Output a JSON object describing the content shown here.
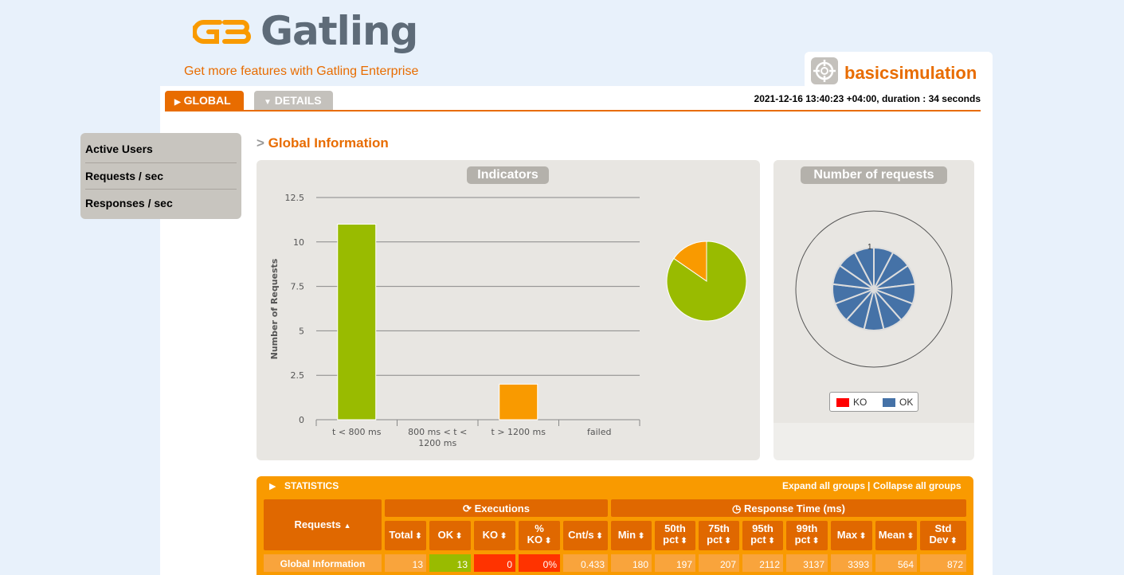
{
  "header": {
    "brand": "Gatling",
    "enterprise_link": "Get more features with Gatling Enterprise",
    "simulation_name": "basicsimulation",
    "run_info": "2021-12-16 13:40:23 +04:00, duration : 34 seconds"
  },
  "tabs": {
    "global": "GLOBAL",
    "details": "DETAILS"
  },
  "sidebar": {
    "items": [
      {
        "label": "Active Users"
      },
      {
        "label": "Requests / sec"
      },
      {
        "label": "Responses / sec"
      }
    ]
  },
  "main": {
    "section_marker": ">",
    "section_title": "Global Information"
  },
  "colors": {
    "accent": "#e86c00",
    "ok_green": "#99bb00",
    "orange": "#f99a00",
    "ko_red": "#ff0000",
    "ok_blue": "#4572a7"
  },
  "chart_data": [
    {
      "type": "bar",
      "title": "Indicators",
      "ylabel": "Number of Requests",
      "categories": [
        "t < 800 ms",
        "800 ms < t < 1200 ms",
        "t > 1200 ms",
        "failed"
      ],
      "values": [
        11,
        0,
        2,
        0
      ],
      "bar_colors": [
        "#99bb00",
        "#ffa500",
        "#f99a00",
        "#ff0000"
      ],
      "ylim": [
        0,
        12.5
      ],
      "yticks": [
        "0",
        "2.5",
        "5",
        "7.5",
        "10",
        "12.5"
      ],
      "grid": true,
      "pie": [
        {
          "label": "t < 800 ms",
          "value": 11,
          "color": "#99bb00"
        },
        {
          "label": "t > 1200 ms",
          "value": 2,
          "color": "#f99a00"
        }
      ]
    },
    {
      "type": "pie",
      "title": "Number of requests",
      "slices": 13,
      "axis_label": "1",
      "legend": [
        {
          "label": "KO",
          "color": "#ff0000"
        },
        {
          "label": "OK",
          "color": "#4572a7"
        }
      ]
    }
  ],
  "statistics": {
    "title": "STATISTICS",
    "expand_label": "Expand all groups",
    "separator": "|",
    "collapse_label": "Collapse all groups",
    "requests_header": "Requests",
    "executions_header": "Executions",
    "response_time_header": "Response Time (ms)",
    "columns": [
      {
        "line1": "Total",
        "line2": ""
      },
      {
        "line1": "OK",
        "line2": ""
      },
      {
        "line1": "KO",
        "line2": ""
      },
      {
        "line1": "%",
        "line2": "KO"
      },
      {
        "line1": "Cnt/s",
        "line2": ""
      },
      {
        "line1": "Min",
        "line2": ""
      },
      {
        "line1": "50th",
        "line2": "pct"
      },
      {
        "line1": "75th",
        "line2": "pct"
      },
      {
        "line1": "95th",
        "line2": "pct"
      },
      {
        "line1": "99th",
        "line2": "pct"
      },
      {
        "line1": "Max",
        "line2": ""
      },
      {
        "line1": "Mean",
        "line2": ""
      },
      {
        "line1": "Std",
        "line2": "Dev"
      }
    ],
    "rows": [
      {
        "name": "Global Information",
        "values": [
          "13",
          "13",
          "0",
          "0%",
          "0.433",
          "180",
          "197",
          "207",
          "2112",
          "3137",
          "3393",
          "564",
          "872"
        ]
      }
    ]
  }
}
